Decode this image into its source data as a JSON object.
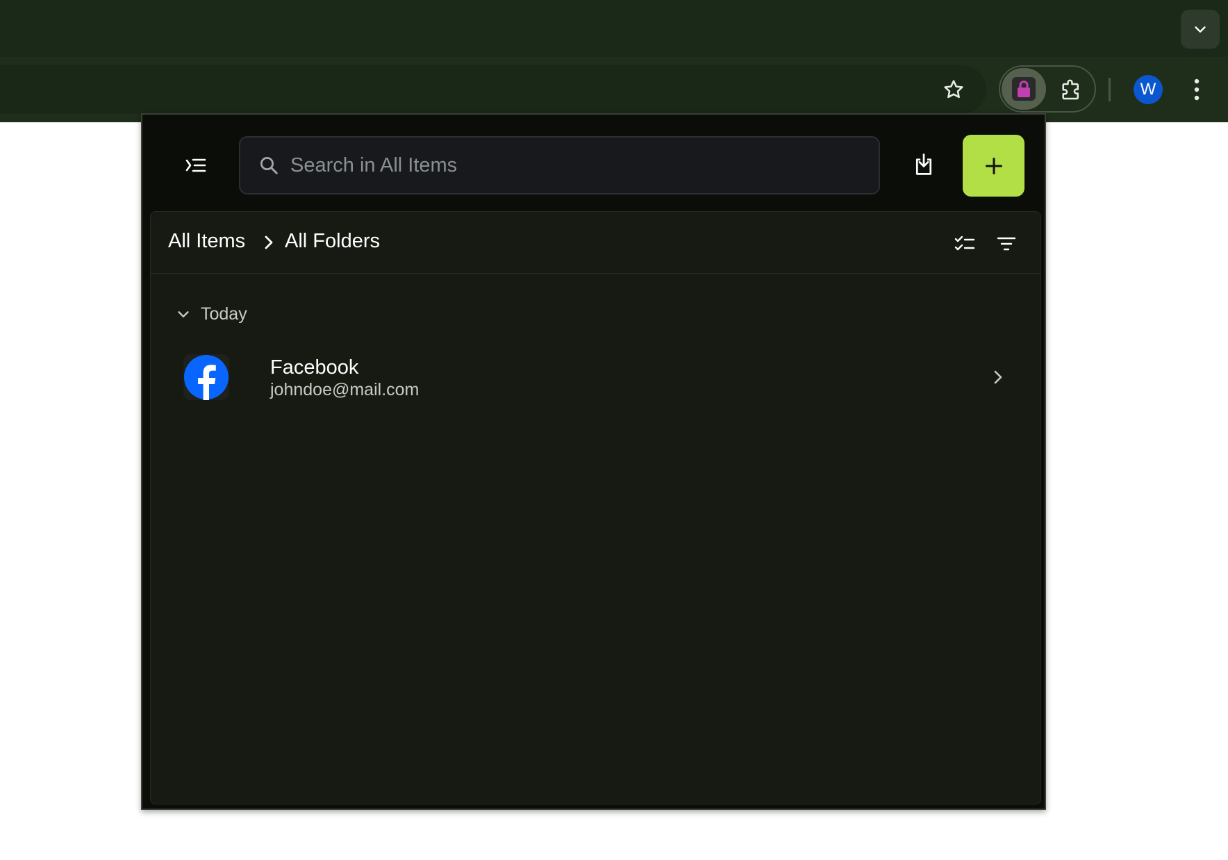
{
  "browser": {
    "profile_initial": "W",
    "colors": {
      "tabstrip": "#1b2a18",
      "toolbar": "#1e2e1b",
      "avatar": "#0b57d0"
    },
    "icons": [
      "chevron-down-icon",
      "star-icon",
      "lock-extension-icon",
      "puzzle-icon",
      "more-vertical-icon"
    ]
  },
  "popup": {
    "search": {
      "placeholder": "Search in All Items",
      "value": ""
    },
    "breadcrumb": {
      "root": "All Items",
      "current": "All Folders"
    },
    "group": {
      "label": "Today"
    },
    "items": [
      {
        "title": "Facebook",
        "subtitle": "johndoe@mail.com",
        "icon": "facebook-icon"
      }
    ],
    "colors": {
      "accent": "#b2df45",
      "background": "#0b0d09",
      "panel": "#171913"
    }
  }
}
